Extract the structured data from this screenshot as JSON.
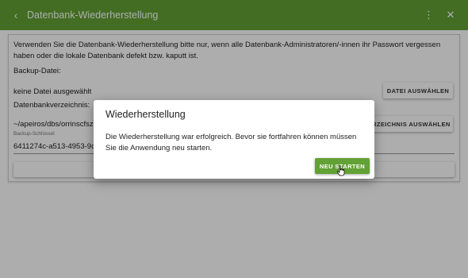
{
  "appbar": {
    "title": "Datenbank-Wiederherstellung",
    "back_icon": "‹",
    "menu_icon": "⋮",
    "close_icon": "✕",
    "color": "#62a134"
  },
  "card": {
    "intro": "Verwenden Sie die Datenbank-Wiederherstellung bitte nur, wenn alle Datenbank-Administratoren/-innen ihr Passwort vergessen haben oder die lokale Datenbank defekt bzw. kaputt ist.",
    "backup_file_label": "Backup-Datei:",
    "no_file_text": "keine Datei ausgewählt",
    "select_file_button": "DATEI AUSWÄHLEN",
    "directory_label": "Datenbankverzeichnis:",
    "directory_value": "~/apeiros/dbs/orrinscfsz",
    "select_directory_button": "VERZEICHNIS AUSWÄHLEN",
    "backup_key_label": "Backup-Schlüssel",
    "backup_key_value": "6411274c-a513-4953-9c56"
  },
  "dialog": {
    "title": "Wiederherstellung",
    "message": "Die Wiederherstellung war erfolgreich. Bevor sie fortfahren können müssen Sie die Anwendung neu starten.",
    "restart_button": "NEU STARTEN",
    "button_color": "#62a134"
  }
}
